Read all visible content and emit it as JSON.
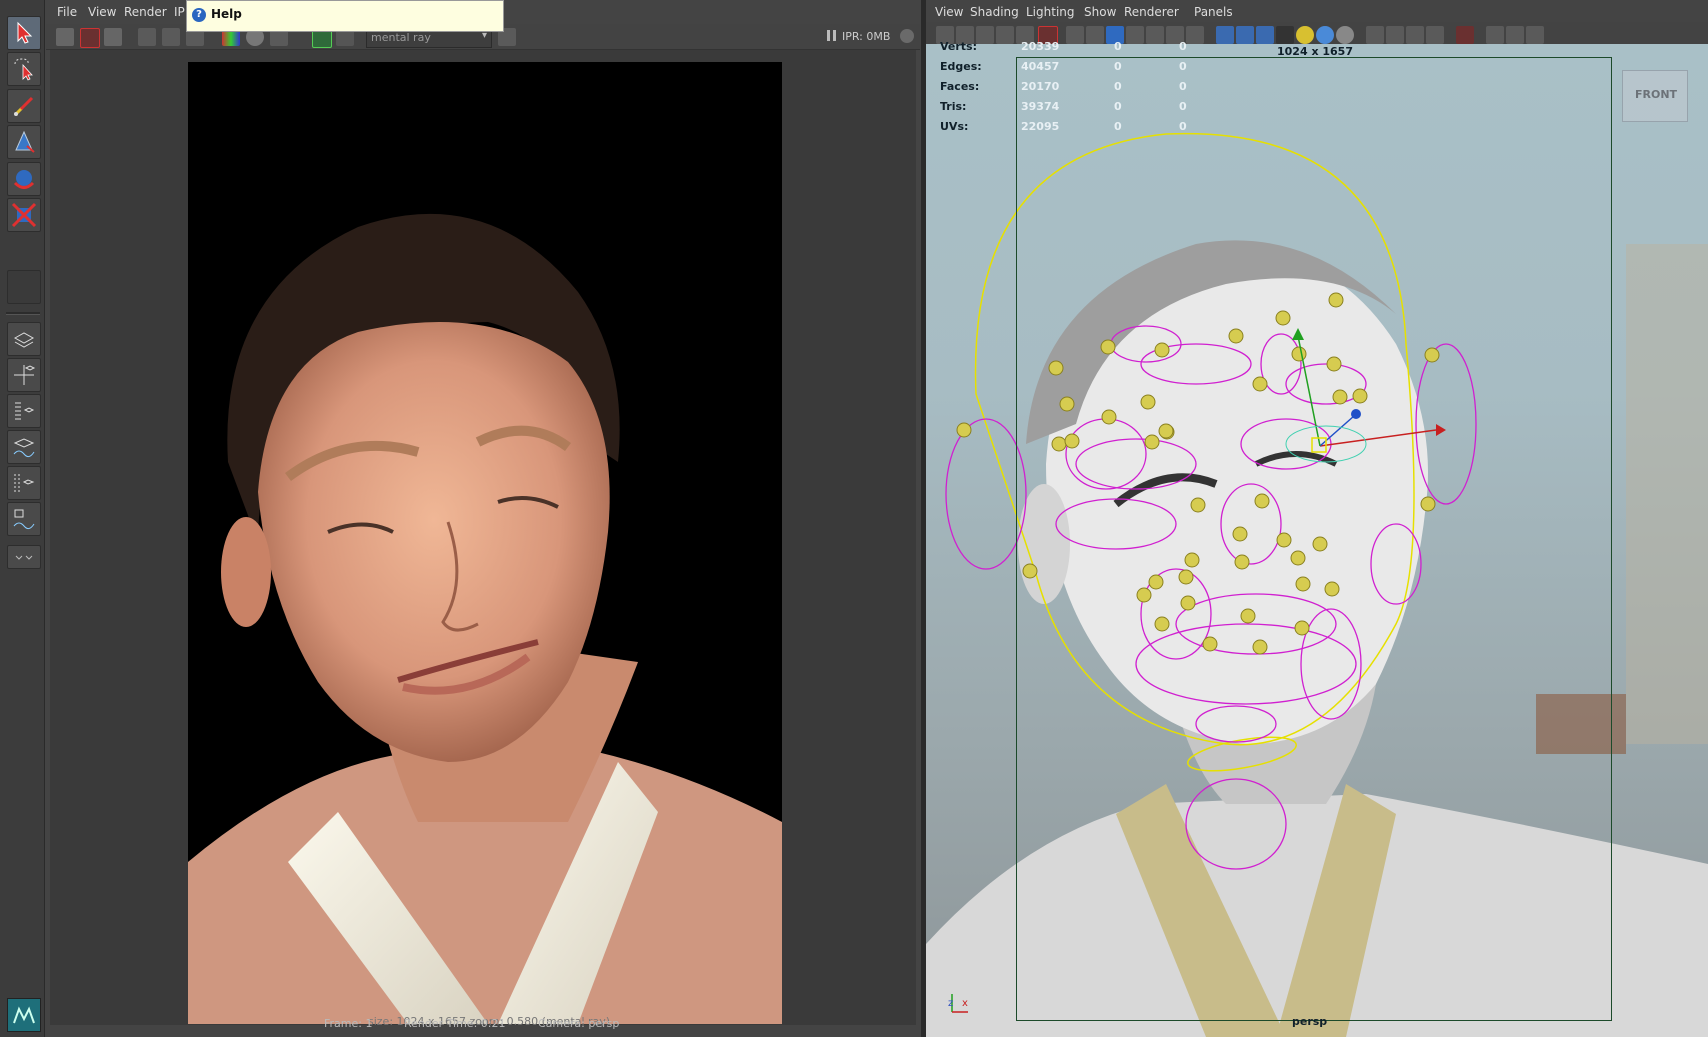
{
  "toolbox": {
    "tools": [
      "select-tool",
      "lasso-tool",
      "paint-select-tool",
      "move-tool",
      "rotate-tool",
      "scale-tool"
    ]
  },
  "render_view": {
    "menu": [
      "File",
      "View",
      "Render",
      "IP"
    ],
    "renderer_select": "mental ray",
    "ipr_label": "IPR: 0MB",
    "status_size": "size: 1024 x 1657  zoom: 0.580     (mental ray)",
    "status_frame": "Frame: 1",
    "status_render_time": "Render Time: 0:21",
    "status_camera": "Camera: persp"
  },
  "help_tooltip": {
    "label": "Help"
  },
  "viewport": {
    "menu": [
      "View",
      "Shading",
      "Lighting",
      "Show",
      "Renderer",
      "Panels"
    ],
    "hud": {
      "rows": [
        {
          "label": "Verts:",
          "value": "20339",
          "a": "0",
          "b": "0"
        },
        {
          "label": "Edges:",
          "value": "40457",
          "a": "0",
          "b": "0"
        },
        {
          "label": "Faces:",
          "value": "20170",
          "a": "0",
          "b": "0"
        },
        {
          "label": "Tris:",
          "value": "39374",
          "a": "0",
          "b": "0"
        },
        {
          "label": "UVs:",
          "value": "22095",
          "a": "0",
          "b": "0"
        }
      ]
    },
    "resolution_label": "1024 x 1657",
    "viewcube_label": "FRONT",
    "camera_label": "persp",
    "axis_z": "z",
    "axis_x": "x"
  }
}
